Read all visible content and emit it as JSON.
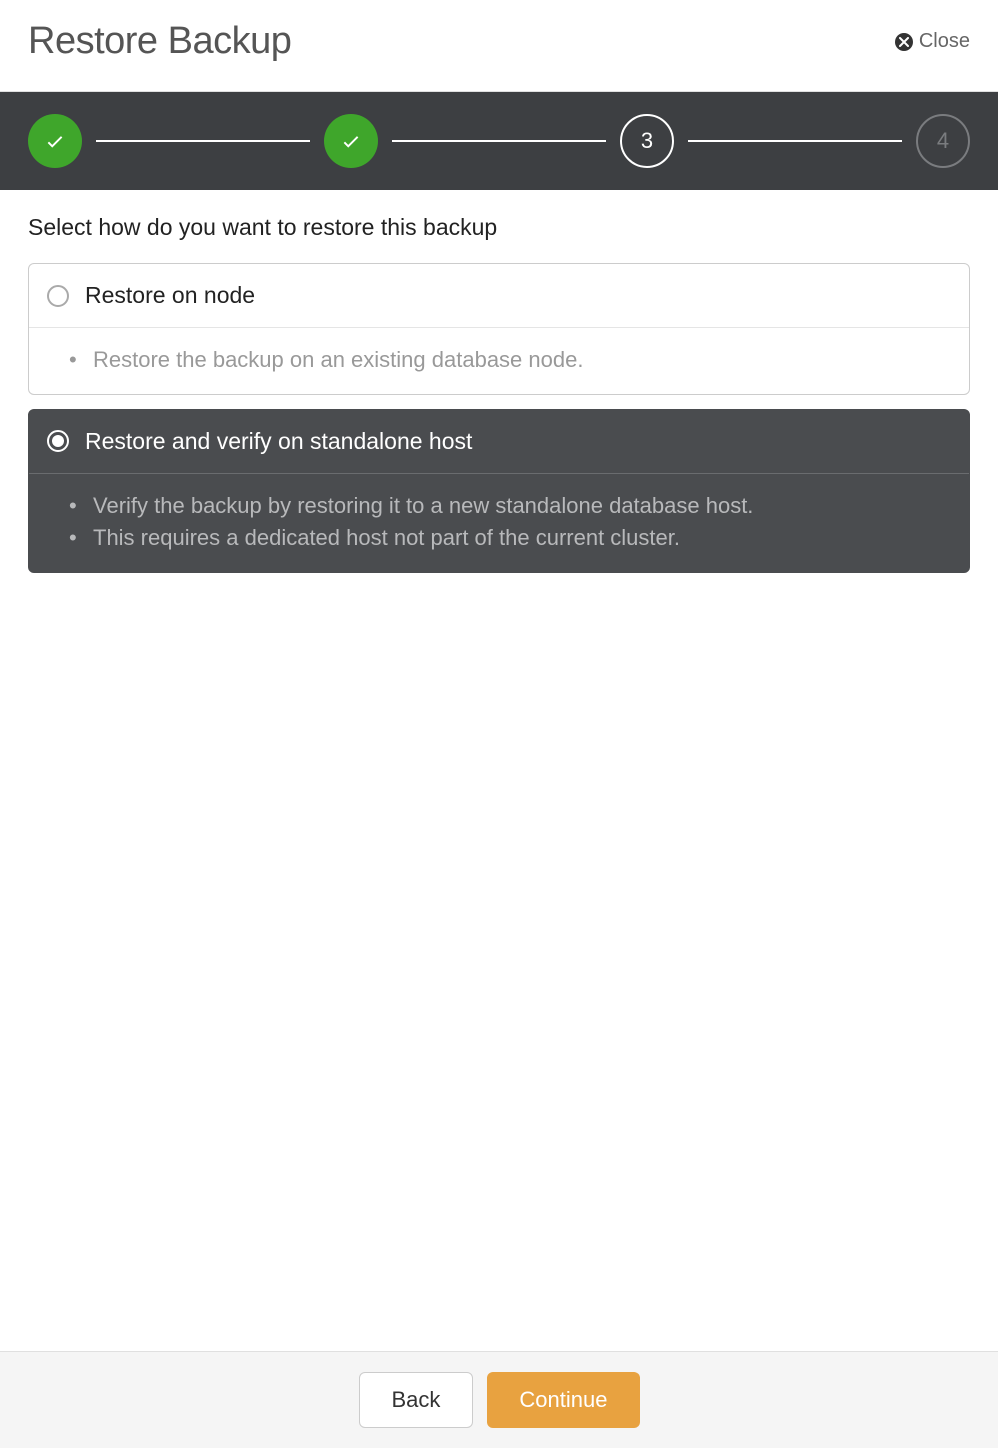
{
  "header": {
    "title": "Restore Backup",
    "close_label": "Close"
  },
  "stepper": {
    "steps": [
      {
        "state": "done"
      },
      {
        "state": "done"
      },
      {
        "state": "active",
        "label": "3"
      },
      {
        "state": "pending",
        "label": "4"
      }
    ]
  },
  "instruction": "Select how do you want to restore this backup",
  "options": [
    {
      "title": "Restore on node",
      "selected": false,
      "details": [
        "Restore the backup on an existing database node."
      ]
    },
    {
      "title": "Restore and verify on standalone host",
      "selected": true,
      "details": [
        "Verify the backup by restoring it to a new standalone database host.",
        "This requires a dedicated host not part of the current cluster."
      ]
    }
  ],
  "footer": {
    "back_label": "Back",
    "continue_label": "Continue"
  }
}
